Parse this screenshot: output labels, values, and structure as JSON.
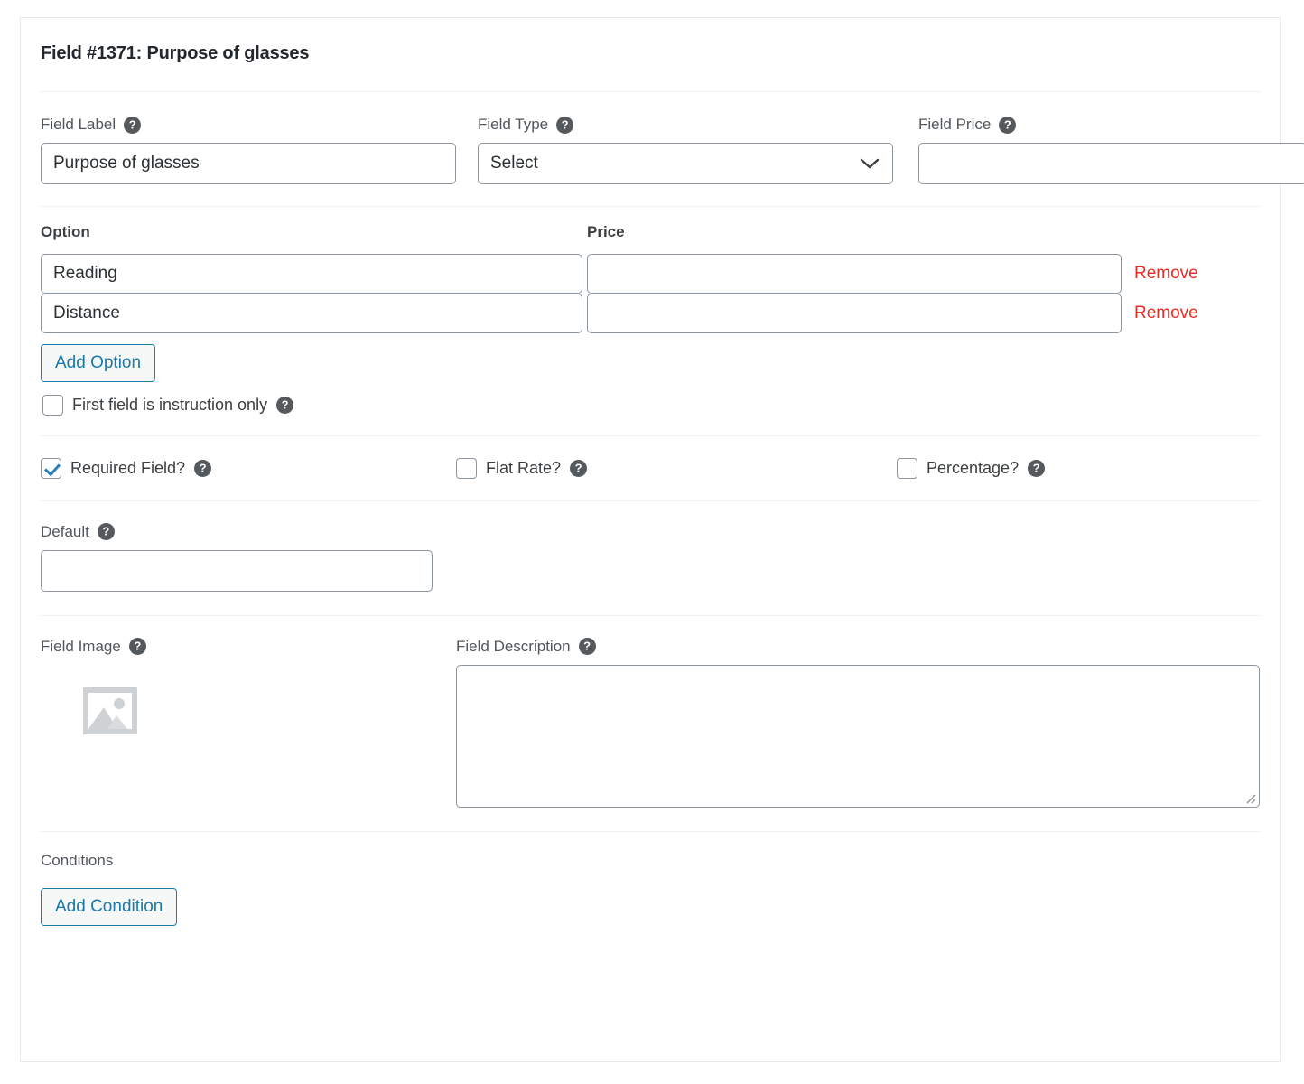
{
  "panel": {
    "title": "Field #1371: Purpose of glasses"
  },
  "help_glyph": "?",
  "top_row": {
    "field_label": {
      "label": "Field Label",
      "value": "Purpose of glasses",
      "placeholder": ""
    },
    "field_type": {
      "label": "Field Type",
      "value": "Select",
      "options": [
        "Select"
      ]
    },
    "field_price": {
      "label": "Field Price",
      "value": "",
      "placeholder": ""
    }
  },
  "options_section": {
    "col_option": "Option",
    "col_price": "Price",
    "rows": [
      {
        "option": "Reading",
        "price": "",
        "remove_label": "Remove"
      },
      {
        "option": "Distance",
        "price": "",
        "remove_label": "Remove"
      }
    ],
    "add_option_label": "Add Option",
    "instruction_checkbox": {
      "label": "First field is instruction only",
      "checked": false
    }
  },
  "checks_row": {
    "required": {
      "label": "Required Field?",
      "checked": true
    },
    "flat_rate": {
      "label": "Flat Rate?",
      "checked": false
    },
    "percentage": {
      "label": "Percentage?",
      "checked": false
    }
  },
  "default_section": {
    "label": "Default",
    "value": "",
    "placeholder": ""
  },
  "media_section": {
    "image_label": "Field Image",
    "image_icon": "image-placeholder-icon",
    "description_label": "Field Description",
    "description_value": "",
    "description_placeholder": ""
  },
  "conditions_section": {
    "label": "Conditions",
    "add_condition_label": "Add Condition"
  },
  "colors": {
    "accent_blue": "#1b7aa8",
    "remove_red": "#ec2b25",
    "checkbox_check": "#2a7fb8",
    "border_gray": "#8d969e",
    "divider": "#eeeeee",
    "text_dark": "#23282d",
    "help_bg": "#56595c"
  }
}
